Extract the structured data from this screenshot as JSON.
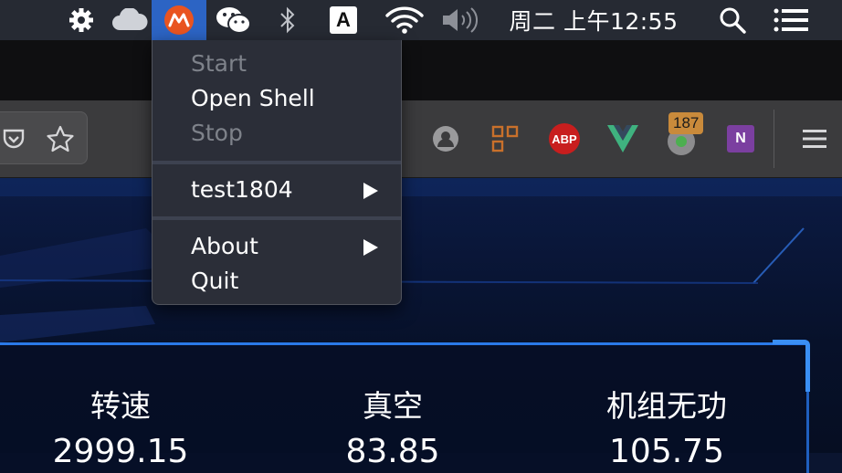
{
  "menubar": {
    "clock": "周二 上午12:55",
    "input_source": "A"
  },
  "menu": {
    "items": [
      {
        "label": "Start",
        "enabled": false
      },
      {
        "label": "Open Shell",
        "enabled": true
      },
      {
        "label": "Stop",
        "enabled": false
      },
      {
        "label": "test1804",
        "enabled": true,
        "submenu": true
      },
      {
        "label": "About",
        "enabled": true,
        "submenu": true
      },
      {
        "label": "Quit",
        "enabled": true
      }
    ]
  },
  "browser": {
    "extension_badge": "187",
    "abp_label": "ABP",
    "onenote_label": "N"
  },
  "dashboard": {
    "metrics": [
      {
        "label": "转速",
        "value": "2999.15"
      },
      {
        "label": "真空",
        "value": "83.85"
      },
      {
        "label": "机组无功",
        "value": "105.75"
      }
    ]
  },
  "colors": {
    "menubar_bg": "#262a33",
    "active_item_bg": "#2c64c4",
    "menu_bg": "#2b2e38",
    "disabled_text": "#7e828a",
    "dashboard_accent": "#2a79e8"
  }
}
